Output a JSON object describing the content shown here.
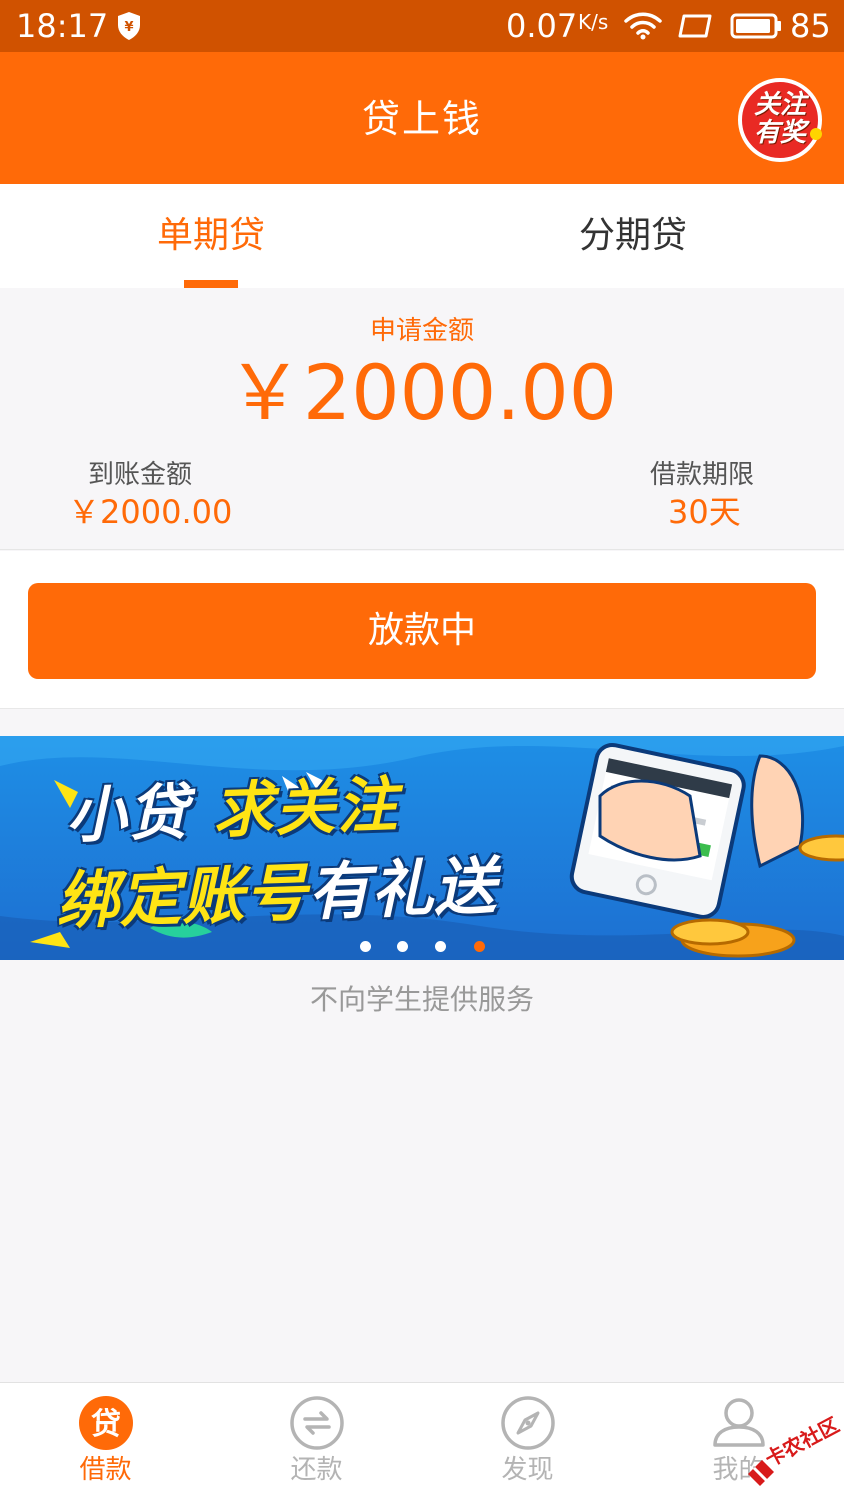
{
  "status_bar": {
    "time": "18:17",
    "speed": "0.07",
    "speed_unit": "K/s",
    "battery_level": "85"
  },
  "header": {
    "title": "贷上钱",
    "promo_line1": "关注",
    "promo_line2": "有奖"
  },
  "tabs": [
    {
      "label": "单期贷",
      "active": true
    },
    {
      "label": "分期贷",
      "active": false
    }
  ],
  "loan": {
    "apply_label": "申请金额",
    "apply_amount": "￥2000.00",
    "received_label": "到账金额",
    "received_amount": "￥2000.00",
    "term_label": "借款期限",
    "term_value": "30天"
  },
  "action": {
    "button_label": "放款中"
  },
  "banner": {
    "line1_a": "小贷",
    "line1_b": "求关注",
    "line2_a": "绑定账号",
    "line2_b": "有礼送",
    "slide_count": 4,
    "active_slide": 4
  },
  "notice": "不向学生提供服务",
  "bottom_nav": [
    {
      "label": "借款",
      "icon": "loan-icon",
      "active": true,
      "glyph": "贷"
    },
    {
      "label": "还款",
      "icon": "repay-icon",
      "active": false
    },
    {
      "label": "发现",
      "icon": "compass-icon",
      "active": false
    },
    {
      "label": "我的",
      "icon": "user-icon",
      "active": false
    }
  ],
  "colors": {
    "brand": "#ff6a08",
    "status_bar": "#d05200",
    "muted": "#b4b4b4"
  },
  "watermark": "卡农社区"
}
